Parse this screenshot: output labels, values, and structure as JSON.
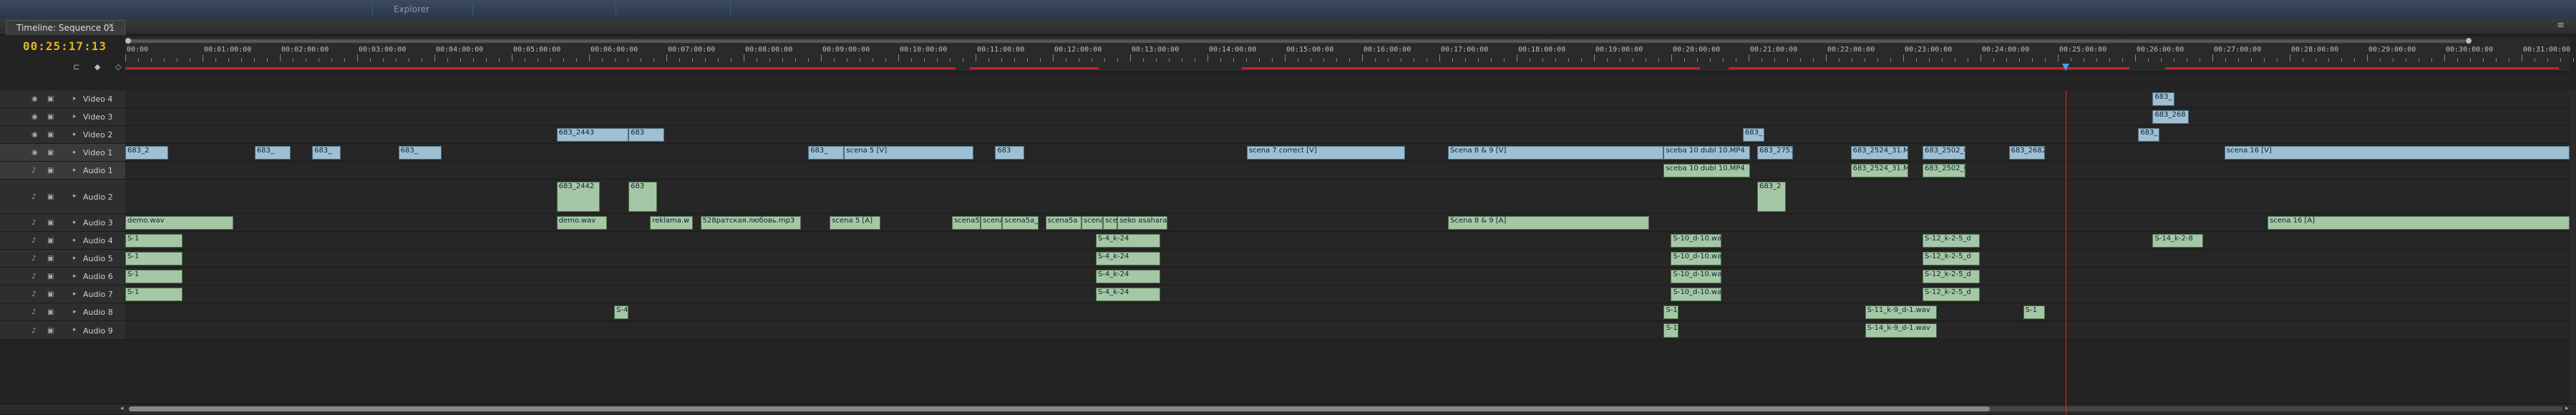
{
  "window": {
    "tab_title": "Timeline: Sequence 01",
    "close_glyph": "×",
    "menu_glyph": "≡",
    "background_tabs": [
      "",
      "Explorer",
      "",
      ""
    ]
  },
  "timecode": "00:25:17:13",
  "tools": [
    {
      "icon": "snap-icon",
      "glyph": "⊏"
    },
    {
      "icon": "marker-icon",
      "glyph": "◆"
    },
    {
      "icon": "keyframe-icon",
      "glyph": "◇"
    },
    {
      "icon": "wrench-icon",
      "glyph": "✎"
    }
  ],
  "ruler": {
    "labels": [
      "00:00",
      "00:01:00:00",
      "00:02:00:00",
      "00:03:00:00",
      "00:04:00:00",
      "00:05:00:00",
      "00:06:00:00",
      "00:07:00:00",
      "00:08:00:00",
      "00:09:00:00",
      "00:10:00:00",
      "00:11:00:00",
      "00:12:00:00",
      "00:13:00:00",
      "00:14:00:00",
      "00:15:00:00",
      "00:16:00:00",
      "00:17:00:00",
      "00:18:00:00",
      "00:19:00:00",
      "00:20:00:00",
      "00:21:00:00",
      "00:22:00:00",
      "00:23:00:00",
      "00:24:00:00",
      "00:25:00:00",
      "00:26:00:00",
      "00:27:00:00",
      "00:28:00:00",
      "00:29:00:00",
      "00:30:00:00",
      "00:31:00:00"
    ]
  },
  "tracks": [
    {
      "name": "Video 4",
      "kind": "video",
      "sel": false
    },
    {
      "name": "Video 3",
      "kind": "video",
      "sel": false
    },
    {
      "name": "Video 2",
      "kind": "video",
      "sel": false
    },
    {
      "name": "Video 1",
      "kind": "video",
      "sel": true
    },
    {
      "name": "Audio 1",
      "kind": "audio",
      "sel": true
    },
    {
      "name": "Audio 2",
      "kind": "audio",
      "sel": false
    },
    {
      "name": "Audio 3",
      "kind": "audio",
      "sel": false
    },
    {
      "name": "Audio 4",
      "kind": "audio",
      "sel": false
    },
    {
      "name": "Audio 5",
      "kind": "audio",
      "sel": false
    },
    {
      "name": "Audio 6",
      "kind": "audio",
      "sel": false
    },
    {
      "name": "Audio 7",
      "kind": "audio",
      "sel": false
    },
    {
      "name": "Audio 8",
      "kind": "audio",
      "sel": false
    },
    {
      "name": "Audio 9",
      "kind": "audio",
      "sel": false
    }
  ],
  "clips": {
    "video4": [
      {
        "label": "683_",
        "start": 2.82,
        "dur": 0.03
      }
    ],
    "video3": [
      {
        "label": "683_268",
        "start": 2.82,
        "dur": 0.05
      }
    ],
    "video2": [
      {
        "label": "683_2443",
        "start": 0.6,
        "dur": 0.1
      },
      {
        "label": "683",
        "start": 0.7,
        "dur": 0.05
      },
      {
        "label": "683_",
        "start": 2.25,
        "dur": 0.03
      },
      {
        "label": "683_",
        "start": 2.8,
        "dur": 0.03
      }
    ],
    "video1": [
      {
        "label": "683_2",
        "start": 0.0,
        "dur": 0.06
      },
      {
        "label": "683_",
        "start": 0.18,
        "dur": 0.05
      },
      {
        "label": "683_",
        "start": 0.26,
        "dur": 0.04
      },
      {
        "label": "683_",
        "start": 0.38,
        "dur": 0.06
      },
      {
        "label": "683_",
        "start": 0.95,
        "dur": 0.05
      },
      {
        "label": "scena 5 [V]",
        "start": 1.0,
        "dur": 0.18
      },
      {
        "label": "683",
        "start": 1.21,
        "dur": 0.04
      },
      {
        "label": "scena 7 correct [V]",
        "start": 1.56,
        "dur": 0.22
      },
      {
        "label": "Scena 8 & 9 [V]",
        "start": 1.84,
        "dur": 0.3
      },
      {
        "label": "sceba 10 dubl 10.MP4",
        "start": 2.14,
        "dur": 0.12
      },
      {
        "label": "683_2751",
        "start": 2.27,
        "dur": 0.05
      },
      {
        "label": "683_2524_31.MP",
        "start": 2.4,
        "dur": 0.08
      },
      {
        "label": "683_2502_02",
        "start": 2.5,
        "dur": 0.06
      },
      {
        "label": "683_2682",
        "start": 2.62,
        "dur": 0.05
      },
      {
        "label": "scena 16 [V]",
        "start": 2.92,
        "dur": 0.48
      }
    ],
    "audio1": [
      {
        "label": "sceba 10 dubl 10.MP4",
        "start": 2.14,
        "dur": 0.12
      },
      {
        "label": "683_2524_31.MP",
        "start": 2.4,
        "dur": 0.08
      },
      {
        "label": "683_2502_02",
        "start": 2.5,
        "dur": 0.06
      }
    ],
    "audio2": [
      {
        "label": "683_2442",
        "start": 0.6,
        "dur": 0.06
      },
      {
        "label": "683",
        "start": 0.7,
        "dur": 0.04
      },
      {
        "label": "683_2",
        "start": 2.27,
        "dur": 0.04
      }
    ],
    "audio3": [
      {
        "label": "demo.wav",
        "start": 0.0,
        "dur": 0.15
      },
      {
        "label": "demo.wav",
        "start": 0.6,
        "dur": 0.07
      },
      {
        "label": "reklama.w",
        "start": 0.73,
        "dur": 0.06
      },
      {
        "label": "528ратская.любовь.mp3",
        "start": 0.8,
        "dur": 0.14
      },
      {
        "label": "scena 5 [A]",
        "start": 0.98,
        "dur": 0.07
      },
      {
        "label": "scena5",
        "start": 1.15,
        "dur": 0.04
      },
      {
        "label": "scena",
        "start": 1.19,
        "dur": 0.03
      },
      {
        "label": "scena5a_1lha",
        "start": 1.22,
        "dur": 0.05
      },
      {
        "label": "scena5a",
        "start": 1.28,
        "dur": 0.05
      },
      {
        "label": "scena7",
        "start": 1.33,
        "dur": 0.03
      },
      {
        "label": "sce",
        "start": 1.36,
        "dur": 0.02
      },
      {
        "label": "seko asahara",
        "start": 1.38,
        "dur": 0.07
      },
      {
        "label": "Scena 8 & 9 [A]",
        "start": 1.84,
        "dur": 0.28
      },
      {
        "label": "scena 16 [A]",
        "start": 2.98,
        "dur": 0.42
      }
    ],
    "audio4": [
      {
        "label": "S-1",
        "start": 0.0,
        "dur": 0.08
      },
      {
        "label": "S-4_k-24",
        "start": 1.35,
        "dur": 0.09
      },
      {
        "label": "S-10_d-10.wav",
        "start": 2.15,
        "dur": 0.07
      },
      {
        "label": "S-12_k-2-5_d",
        "start": 2.5,
        "dur": 0.08
      },
      {
        "label": "S-14_k-2-8",
        "start": 2.82,
        "dur": 0.07
      }
    ],
    "audio5": [
      {
        "label": "S-1",
        "start": 0.0,
        "dur": 0.08
      },
      {
        "label": "S-4_k-24",
        "start": 1.35,
        "dur": 0.09
      },
      {
        "label": "S-10_d-10.wav",
        "start": 2.15,
        "dur": 0.07
      },
      {
        "label": "S-12_k-2-5_d",
        "start": 2.5,
        "dur": 0.08
      }
    ],
    "audio6": [
      {
        "label": "S-1",
        "start": 0.0,
        "dur": 0.08
      },
      {
        "label": "S-4_k-24",
        "start": 1.35,
        "dur": 0.09
      },
      {
        "label": "S-10_d-10.wav",
        "start": 2.15,
        "dur": 0.07
      },
      {
        "label": "S-12_k-2-5_d",
        "start": 2.5,
        "dur": 0.08
      }
    ],
    "audio7": [
      {
        "label": "S-1",
        "start": 0.0,
        "dur": 0.08
      },
      {
        "label": "S-4_k-24",
        "start": 1.35,
        "dur": 0.09
      },
      {
        "label": "S-10_d-10.wav",
        "start": 2.15,
        "dur": 0.07
      },
      {
        "label": "S-12_k-2-5_d",
        "start": 2.5,
        "dur": 0.08
      }
    ],
    "audio8": [
      {
        "label": "S-4",
        "start": 0.68,
        "dur": 0.02
      },
      {
        "label": "S-1",
        "start": 2.14,
        "dur": 0.02
      },
      {
        "label": "S-11_k-9_d-1.wav",
        "start": 2.42,
        "dur": 0.1
      },
      {
        "label": "S-1",
        "start": 2.64,
        "dur": 0.03
      }
    ],
    "audio9": [
      {
        "label": "S-1",
        "start": 2.14,
        "dur": 0.02
      },
      {
        "label": "S-14_k-9_d-1.wav",
        "start": 2.42,
        "dur": 0.1
      }
    ]
  }
}
